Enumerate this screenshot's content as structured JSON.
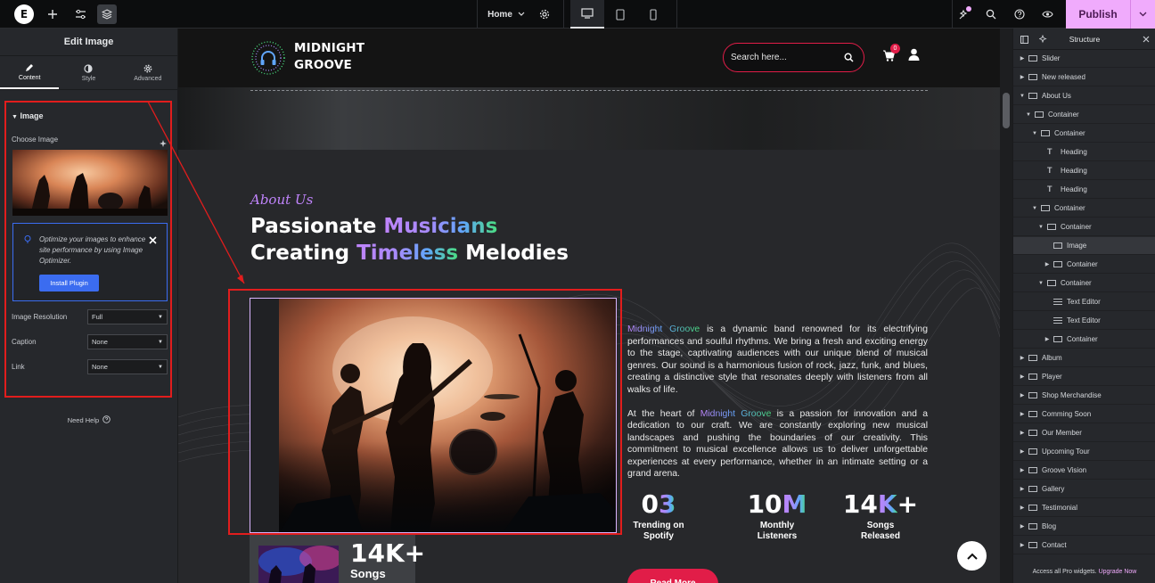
{
  "topbar": {
    "page_select": "Home",
    "publish": "Publish"
  },
  "left_panel": {
    "title": "Edit Image",
    "tabs": [
      {
        "label": "Content",
        "icon": "pencil-icon"
      },
      {
        "label": "Style",
        "icon": "half-circle-icon"
      },
      {
        "label": "Advanced",
        "icon": "gear-icon"
      }
    ],
    "section": "Image",
    "choose_image": "Choose Image",
    "optimizer_text": "Optimize your images to enhance site performance by using Image Optimizer.",
    "install_plugin": "Install Plugin",
    "fields": [
      {
        "label": "Image Resolution",
        "value": "Full"
      },
      {
        "label": "Caption",
        "value": "None"
      },
      {
        "label": "Link",
        "value": "None"
      }
    ],
    "need_help": "Need Help"
  },
  "site": {
    "brand_line1": "MIDNIGHT",
    "brand_line2": "GROOVE",
    "search_placeholder": "Search here...",
    "cart_count": "0",
    "about_tag": "About Us",
    "headline": {
      "l1_a": "Passionate ",
      "l1_b": "Musicians",
      "l2_a": "Creating ",
      "l2_b": "Timeless",
      "l2_c": " Melodies"
    },
    "para1_brand": "Midnight Groove",
    "para1_rest": " is a dynamic band renowned for its electrifying performances and soulful rhythms. We bring a fresh and exciting energy to the stage, captivating audiences with our unique blend of musical genres. Our sound is a harmonious fusion of rock, jazz, funk, and blues, creating a distinctive style that resonates deeply with listeners from all walks of life.",
    "para2_a": "At the heart of ",
    "para2_brand": "Midnight Groove",
    "para2_rest": " is a passion for innovation and a dedication to our craft. We are constantly exploring new musical landscapes and pushing the boundaries of our creativity. This commitment to musical excellence allows us to deliver unforgettable experiences at every performance, whether in an intimate setting or a grand arena.",
    "stats": [
      {
        "num_a": "0",
        "num_b": "3",
        "label1": "Trending on",
        "label2": "Spotify"
      },
      {
        "num_a": "10",
        "num_b": "M",
        "label1": "Monthly",
        "label2": "Listeners"
      },
      {
        "num_a": "14",
        "num_b": "K",
        "num_c": "+",
        "label1": "Songs",
        "label2": "Released"
      }
    ],
    "read_more": "Read More",
    "mini_card": {
      "num": "14K+",
      "label": "Songs"
    }
  },
  "structure": {
    "title": "Structure",
    "nodes": [
      {
        "label": "Slider",
        "depth": 0,
        "caret": "right",
        "icon": "box"
      },
      {
        "label": "New released",
        "depth": 0,
        "caret": "right",
        "icon": "box"
      },
      {
        "label": "About Us",
        "depth": 0,
        "caret": "down",
        "icon": "box"
      },
      {
        "label": "Container",
        "depth": 1,
        "caret": "down",
        "icon": "box"
      },
      {
        "label": "Container",
        "depth": 2,
        "caret": "down",
        "icon": "box"
      },
      {
        "label": "Heading",
        "depth": 3,
        "caret": "none",
        "icon": "text"
      },
      {
        "label": "Heading",
        "depth": 3,
        "caret": "none",
        "icon": "text"
      },
      {
        "label": "Heading",
        "depth": 3,
        "caret": "none",
        "icon": "text"
      },
      {
        "label": "Container",
        "depth": 2,
        "caret": "down",
        "icon": "box"
      },
      {
        "label": "Container",
        "depth": 3,
        "caret": "down",
        "icon": "box"
      },
      {
        "label": "Image",
        "depth": 4,
        "caret": "none",
        "icon": "image",
        "selected": true
      },
      {
        "label": "Container",
        "depth": 4,
        "caret": "right",
        "icon": "box"
      },
      {
        "label": "Container",
        "depth": 3,
        "caret": "down",
        "icon": "box"
      },
      {
        "label": "Text Editor",
        "depth": 4,
        "caret": "none",
        "icon": "lines"
      },
      {
        "label": "Text Editor",
        "depth": 4,
        "caret": "none",
        "icon": "lines"
      },
      {
        "label": "Container",
        "depth": 4,
        "caret": "right",
        "icon": "box"
      },
      {
        "label": "Album",
        "depth": 0,
        "caret": "right",
        "icon": "box"
      },
      {
        "label": "Player",
        "depth": 0,
        "caret": "right",
        "icon": "box"
      },
      {
        "label": "Shop Merchandise",
        "depth": 0,
        "caret": "right",
        "icon": "box"
      },
      {
        "label": "Comming Soon",
        "depth": 0,
        "caret": "right",
        "icon": "box"
      },
      {
        "label": "Our Member",
        "depth": 0,
        "caret": "right",
        "icon": "box"
      },
      {
        "label": "Upcoming Tour",
        "depth": 0,
        "caret": "right",
        "icon": "box"
      },
      {
        "label": "Groove Vision",
        "depth": 0,
        "caret": "right",
        "icon": "box"
      },
      {
        "label": "Gallery",
        "depth": 0,
        "caret": "right",
        "icon": "box"
      },
      {
        "label": "Testimonial",
        "depth": 0,
        "caret": "right",
        "icon": "box"
      },
      {
        "label": "Blog",
        "depth": 0,
        "caret": "right",
        "icon": "box"
      },
      {
        "label": "Contact",
        "depth": 0,
        "caret": "right",
        "icon": "box"
      }
    ],
    "pro_text": "Access all Pro widgets.",
    "pro_link": "Upgrade Now"
  },
  "colors": {
    "accent_pink": "#e11d48",
    "publish": "#f0abfc",
    "selection_red": "#e11d1d",
    "editor_blue": "#3b6cf0"
  }
}
